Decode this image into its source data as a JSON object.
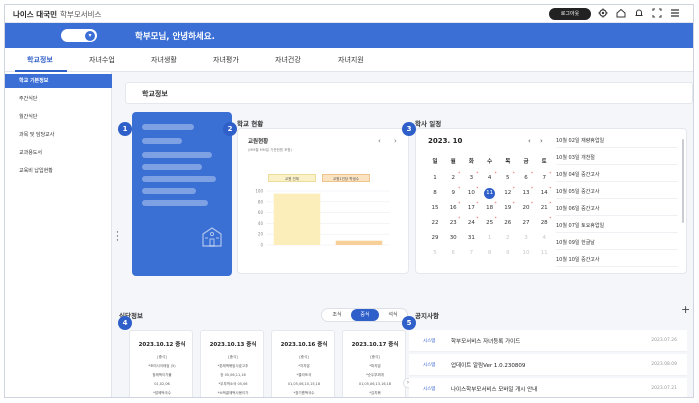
{
  "header": {
    "brand": "나이스 대국민",
    "brand_sub": "학부모서비스",
    "login_label": "로그아웃",
    "icons": [
      "gear-icon",
      "home-icon",
      "bell-icon",
      "expand-icon",
      "menu-icon"
    ]
  },
  "banner": {
    "greeting": "학부모님, 안녕하세요."
  },
  "nav": {
    "tabs": [
      {
        "label": "학교정보",
        "active": true
      },
      {
        "label": "자녀수업",
        "active": false
      },
      {
        "label": "자녀생활",
        "active": false
      },
      {
        "label": "자녀평가",
        "active": false
      },
      {
        "label": "자녀건강",
        "active": false
      },
      {
        "label": "자녀지원",
        "active": false
      }
    ]
  },
  "sidebar": {
    "items": [
      {
        "label": "학교 기본정보",
        "active": true
      },
      {
        "label": "주간식단",
        "active": false
      },
      {
        "label": "월간식단",
        "active": false
      },
      {
        "label": "과목 및 담당교사",
        "active": false
      },
      {
        "label": "교과용도서",
        "active": false
      },
      {
        "label": "교육비 납입현황",
        "active": false
      }
    ]
  },
  "main": {
    "school_bar_title": "학교정보",
    "badges": [
      "1",
      "2",
      "3",
      "4",
      "5"
    ],
    "school_status": {
      "section_title": "학교 현황",
      "chart_title": "교원현황",
      "chart_sub": "(MM월 MM일 기준현원 포함)",
      "legend": [
        "교원 전체",
        "교원1인당 학생수"
      ]
    },
    "schedule": {
      "section_title": "학사 일정",
      "month": "2023. 10",
      "weekdays": [
        "일",
        "월",
        "화",
        "수",
        "목",
        "금",
        "토"
      ],
      "events": [
        "10월 02일 재량휴업일",
        "10월 03일 개천절",
        "10월 04일 중간고사",
        "10월 05일 중간고사",
        "10월 06일 중간고사",
        "10월 07일 토요휴업일",
        "10월 09일 한글날",
        "10월 10일 중간고사"
      ]
    },
    "meal": {
      "section_title": "식단정보",
      "tabs": [
        "조식",
        "중식",
        "석식"
      ],
      "active_tab": "중식",
      "cards": [
        {
          "date": "2023.10.12 중식",
          "lines": [
            "[중식]",
            "*조미사이태엄 (5)",
            "참깨떡이가물",
            "01,02,06",
            "*밥에떡국수"
          ]
        },
        {
          "date": "2023.10.13 중식",
          "lines": [
            "[중식]",
            "*본레떡볶밥사효고추",
            "장 05,06,11,16",
            "*무부역소국 05,06",
            "*소떡끌깨떡사봉이가"
          ]
        },
        {
          "date": "2023.10.16 중식",
          "lines": [
            "[중식]",
            "*차지밥",
            "*콜라또국",
            "01,05,06,10,15,18",
            "*참기름떡국수"
          ]
        },
        {
          "date": "2023.10.17 중식",
          "lines": [
            "[중식]",
            "*파지밥",
            "*순두부찌개",
            "01,05,06,13,16,18",
            "*김치볶"
          ]
        }
      ]
    },
    "notice": {
      "section_title": "공지사항",
      "items": [
        {
          "tag": "시스템",
          "title": "학부모서비스 자녀등록 가이드",
          "date": "2023.07.26"
        },
        {
          "tag": "시스템",
          "title": "업데이트 알림Ver 1.0.230809",
          "date": "2023.08.09"
        },
        {
          "tag": "시스템",
          "title": "나이스학부모서비스 모바일 개시 안내",
          "date": "2023.07.21"
        }
      ]
    }
  },
  "chart_data": {
    "type": "bar",
    "categories": [
      "교원 전체",
      "교원1인당 학생수"
    ],
    "values": [
      95,
      8
    ],
    "ylim": [
      0,
      100
    ],
    "yticks": [
      0,
      20,
      40,
      60,
      80,
      100
    ],
    "colors": [
      "#fbeebb",
      "#f6cf99"
    ]
  }
}
